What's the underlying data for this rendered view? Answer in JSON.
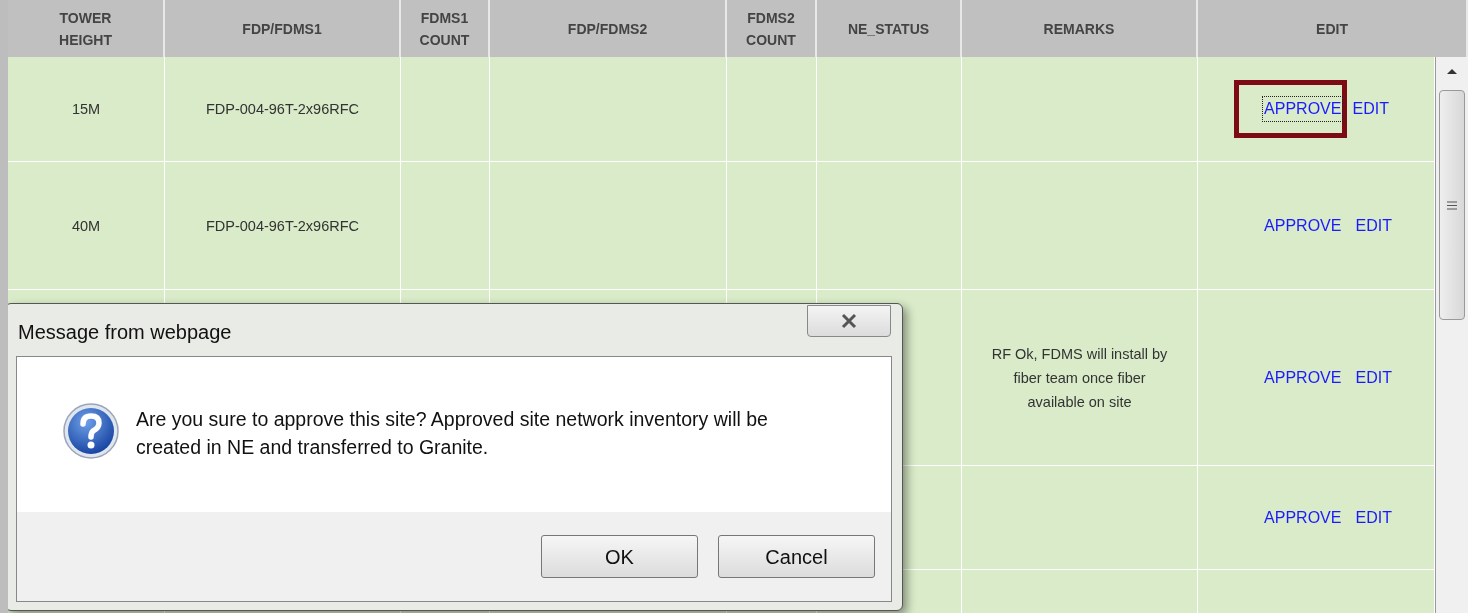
{
  "table": {
    "columns": [
      {
        "lines": [
          "TOWER",
          "HEIGHT"
        ]
      },
      {
        "lines": [
          "FDP/FDMS1"
        ]
      },
      {
        "lines": [
          "FDMS1",
          "COUNT"
        ]
      },
      {
        "lines": [
          "FDP/FDMS2"
        ]
      },
      {
        "lines": [
          "FDMS2",
          "COUNT"
        ]
      },
      {
        "lines": [
          "NE_STATUS"
        ]
      },
      {
        "lines": [
          "REMARKS"
        ]
      },
      {
        "lines": [
          "EDIT"
        ]
      }
    ],
    "rows": [
      {
        "tower_height": "15M",
        "fdp_fdms1": "FDP-004-96T-2x96RFC",
        "actions": [
          {
            "label": "APPROVE",
            "focused": true,
            "highlighted": true
          },
          {
            "label": "EDIT",
            "focused": false,
            "highlighted": false
          }
        ]
      },
      {
        "tower_height": "40M",
        "fdp_fdms1": "FDP-004-96T-2x96RFC",
        "actions": [
          {
            "label": "APPROVE",
            "focused": false,
            "highlighted": false
          },
          {
            "label": "EDIT",
            "focused": false,
            "highlighted": false
          }
        ]
      },
      {
        "remarks": "RF Ok, FDMS will install by fiber team once fiber available on site",
        "actions": [
          {
            "label": "APPROVE",
            "focused": false,
            "highlighted": false
          },
          {
            "label": "EDIT",
            "focused": false,
            "highlighted": false
          }
        ]
      },
      {
        "actions": [
          {
            "label": "APPROVE",
            "focused": false,
            "highlighted": false
          },
          {
            "label": "EDIT",
            "focused": false,
            "highlighted": false
          }
        ]
      }
    ]
  },
  "dialog": {
    "title": "Message from webpage",
    "message": "Are you sure to approve this site? Approved site network inventory will be created in NE and transferred to Granite.",
    "buttons": [
      "OK",
      "Cancel"
    ]
  }
}
